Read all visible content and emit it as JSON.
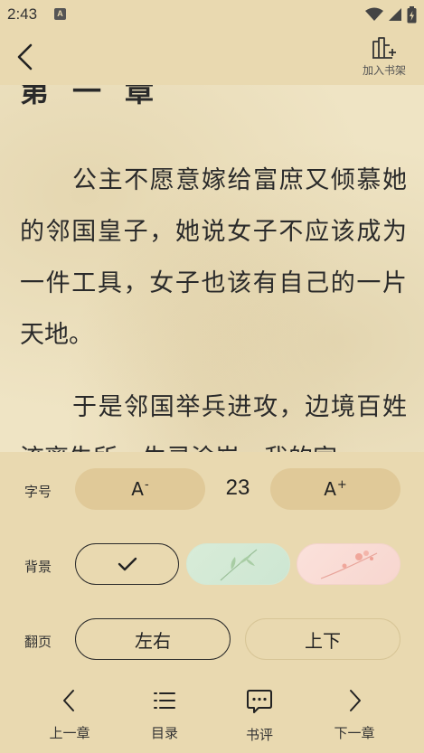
{
  "status_bar": {
    "time": "2:43",
    "app_icon_letter": "A",
    "icons": [
      "wifi-icon",
      "cellular-signal-icon",
      "battery-icon"
    ]
  },
  "header": {
    "back_icon": "chevron-left-icon",
    "bookshelf_icon": "add-to-bookshelf-icon",
    "bookshelf_label": "加入书架"
  },
  "reader": {
    "chapter_heading": "第一章",
    "paragraphs": [
      "公主不愿意嫁给富庶又倾慕她的邻国皇子，她说女子不应该成为一件工具，女子也该有自己的一片天地。",
      "于是邻国举兵进攻，边境百姓流离失所，生灵涂炭，我的家"
    ]
  },
  "settings": {
    "font_size": {
      "label": "字号",
      "decrease_label": "A",
      "decrease_sup": "-",
      "value": "23",
      "increase_label": "A",
      "increase_sup": "+"
    },
    "background": {
      "label": "背景",
      "options": [
        {
          "name": "beige",
          "color": "#e9d9b0",
          "selected": true
        },
        {
          "name": "green",
          "color": "#d4ebd6",
          "selected": false
        },
        {
          "name": "pink",
          "color": "#f9dcd5",
          "selected": false
        }
      ]
    },
    "page_turn": {
      "label": "翻页",
      "options": [
        {
          "label": "左右",
          "selected": true
        },
        {
          "label": "上下",
          "selected": false
        }
      ]
    }
  },
  "bottom_nav": [
    {
      "label": "上一章",
      "icon": "chevron-left-icon"
    },
    {
      "label": "目录",
      "icon": "list-icon"
    },
    {
      "label": "书评",
      "icon": "comment-icon"
    },
    {
      "label": "下一章",
      "icon": "chevron-right-icon"
    }
  ],
  "colors": {
    "background": "#e9d9b0",
    "paper": "#efe4c4",
    "pill_fill": "#e0c998",
    "text": "#222222"
  }
}
